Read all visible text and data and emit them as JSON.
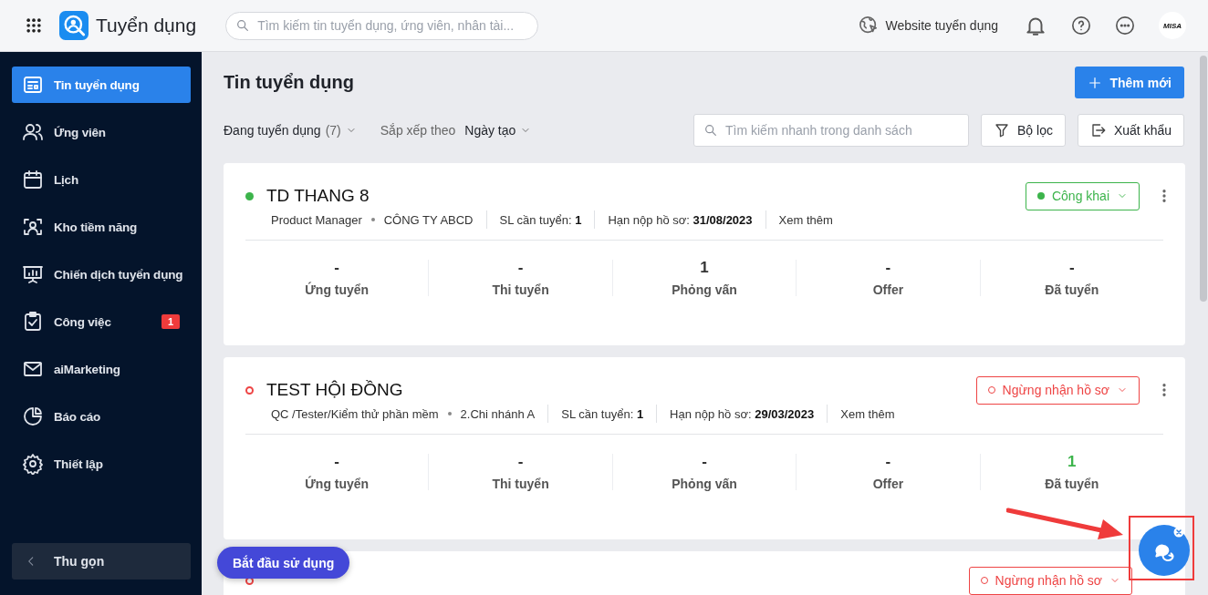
{
  "app": {
    "title": "Tuyển dụng",
    "search_placeholder": "Tìm kiếm tin tuyển dụng, ứng viên, nhân tài...",
    "website_link": "Website tuyển dụng",
    "avatar_text": "MISA"
  },
  "sidebar": {
    "items": [
      {
        "label": "Tin tuyển dụng",
        "selected": true
      },
      {
        "label": "Ứng viên",
        "selected": false
      },
      {
        "label": "Lịch",
        "selected": false
      },
      {
        "label": "Kho tiềm năng",
        "selected": false
      },
      {
        "label": "Chiến dịch tuyển dụng",
        "selected": false
      },
      {
        "label": "Công việc",
        "selected": false,
        "badge": "1"
      },
      {
        "label": "aiMarketing",
        "selected": false
      },
      {
        "label": "Báo cáo",
        "selected": false
      },
      {
        "label": "Thiết lập",
        "selected": false
      }
    ],
    "collapse": "Thu gọn"
  },
  "page": {
    "title": "Tin tuyển dụng",
    "add_button": "Thêm mới",
    "status_filter": "Đang tuyển dụng",
    "status_count": "(7)",
    "sort_label": "Sắp xếp theo",
    "sort_value": "Ngày tạo",
    "search_placeholder": "Tìm kiếm nhanh trong danh sách",
    "filter_button": "Bộ lọc",
    "export_button": "Xuất khẩu"
  },
  "jobs": [
    {
      "title": "TD THANG 8",
      "kind": "public",
      "status_label": "Công khai",
      "position": "Product Manager",
      "company": "CÔNG TY ABCD",
      "quantity_label": "SL cần tuyển:",
      "quantity": "1",
      "deadline_label": "Hạn nộp hồ sơ:",
      "deadline": "31/08/2023",
      "more": "Xem thêm",
      "stages": [
        {
          "value": "-",
          "label": "Ứng tuyển",
          "highlight": false
        },
        {
          "value": "-",
          "label": "Thi tuyển",
          "highlight": false
        },
        {
          "value": "1",
          "label": "Phỏng vấn",
          "highlight": false
        },
        {
          "value": "-",
          "label": "Offer",
          "highlight": false
        },
        {
          "value": "-",
          "label": "Đã tuyển",
          "highlight": false
        }
      ]
    },
    {
      "title": "TEST HỘI ĐỒNG",
      "kind": "closed",
      "status_label": "Ngừng nhận hồ sơ",
      "position": "QC /Tester/Kiểm thử phần mềm",
      "company": "2.Chi nhánh A",
      "quantity_label": "SL cần tuyển:",
      "quantity": "1",
      "deadline_label": "Hạn nộp hồ sơ:",
      "deadline": "29/03/2023",
      "more": "Xem thêm",
      "stages": [
        {
          "value": "-",
          "label": "Ứng tuyển",
          "highlight": false
        },
        {
          "value": "-",
          "label": "Thi tuyển",
          "highlight": false
        },
        {
          "value": "-",
          "label": "Phỏng vấn",
          "highlight": false
        },
        {
          "value": "-",
          "label": "Offer",
          "highlight": false
        },
        {
          "value": "1",
          "label": "Đã tuyển",
          "highlight": true
        }
      ]
    },
    {
      "kind": "closed",
      "status_label": "Ngừng nhận hồ sơ"
    }
  ],
  "start_button": "Bắt đầu sử dụng"
}
